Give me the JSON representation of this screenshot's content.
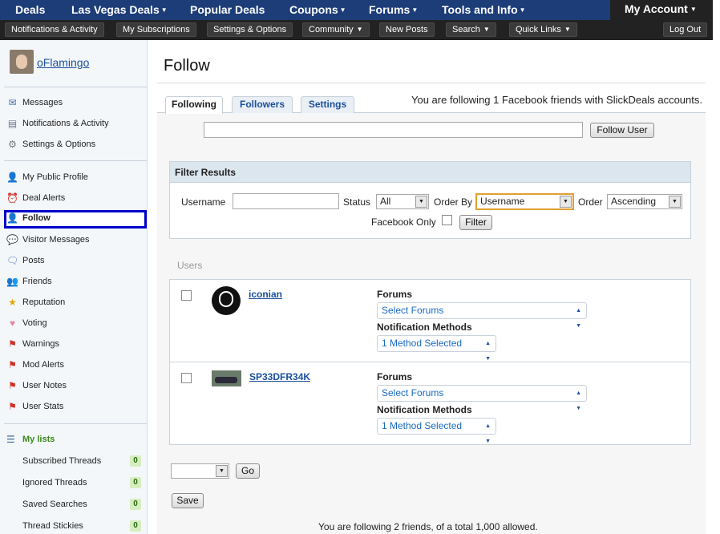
{
  "topnav": {
    "items": [
      {
        "label": "Deals",
        "caret": false
      },
      {
        "label": "Las Vegas Deals",
        "caret": true
      },
      {
        "label": "Popular Deals",
        "caret": false
      },
      {
        "label": "Coupons",
        "caret": true
      },
      {
        "label": "Forums",
        "caret": true
      },
      {
        "label": "Tools and Info",
        "caret": true
      }
    ],
    "my_account": "My Account"
  },
  "subnav": {
    "items": [
      "Notifications & Activity",
      "My Subscriptions",
      "Settings & Options",
      "Community",
      "New Posts",
      "Search",
      "Quick Links"
    ],
    "logout": "Log Out"
  },
  "sidebar": {
    "username": "oFlamingo",
    "group1": [
      {
        "label": "Messages",
        "icon": "envelope-icon"
      },
      {
        "label": "Notifications & Activity",
        "icon": "notifications-icon"
      },
      {
        "label": "Settings & Options",
        "icon": "gear-icon"
      }
    ],
    "group2": [
      {
        "label": "My Public Profile",
        "icon": "person-icon"
      },
      {
        "label": "Deal Alerts",
        "icon": "alarm-icon"
      },
      {
        "label": "Follow",
        "icon": "follow-icon"
      },
      {
        "label": "Visitor Messages",
        "icon": "speech-bubble-icon"
      },
      {
        "label": "Posts",
        "icon": "posts-icon"
      },
      {
        "label": "Friends",
        "icon": "friends-icon"
      },
      {
        "label": "Reputation",
        "icon": "star-icon"
      },
      {
        "label": "Voting",
        "icon": "voting-icon"
      },
      {
        "label": "Warnings",
        "icon": "flag-icon"
      },
      {
        "label": "Mod Alerts",
        "icon": "flag-icon"
      },
      {
        "label": "User Notes",
        "icon": "flag-icon"
      },
      {
        "label": "User Stats",
        "icon": "flag-icon"
      }
    ],
    "my_lists": "My lists",
    "lists": [
      {
        "label": "Subscribed Threads",
        "count": "0"
      },
      {
        "label": "Ignored Threads",
        "count": "0"
      },
      {
        "label": "Saved Searches",
        "count": "0"
      },
      {
        "label": "Thread Stickies",
        "count": "0"
      }
    ]
  },
  "main": {
    "title": "Follow",
    "tabs": [
      "Following",
      "Followers",
      "Settings"
    ],
    "following_text": "You are following 1 Facebook friends with SlickDeals accounts.",
    "follow_input_value": "",
    "follow_user_button": "Follow User",
    "filter": {
      "title": "Filter Results",
      "username_label": "Username",
      "username_value": "",
      "status_label": "Status",
      "status_value": "All",
      "order_by_label": "Order By",
      "order_by_value": "Username",
      "order_label": "Order",
      "order_value": "Ascending",
      "facebook_only_label": "Facebook Only",
      "filter_button": "Filter"
    },
    "users_label": "Users",
    "users": [
      {
        "name": "iconian",
        "forums_label": "Forums",
        "forums_value": "Select Forums",
        "notif_label": "Notification Methods",
        "notif_value": "1 Method Selected"
      },
      {
        "name": "SP33DFR34K",
        "forums_label": "Forums",
        "forums_value": "Select Forums",
        "notif_label": "Notification Methods",
        "notif_value": "1 Method Selected"
      }
    ],
    "bulk_select_value": "",
    "go_button": "Go",
    "save_button": "Save",
    "footer_text": "You are following 2 friends, of a total 1,000 allowed."
  }
}
